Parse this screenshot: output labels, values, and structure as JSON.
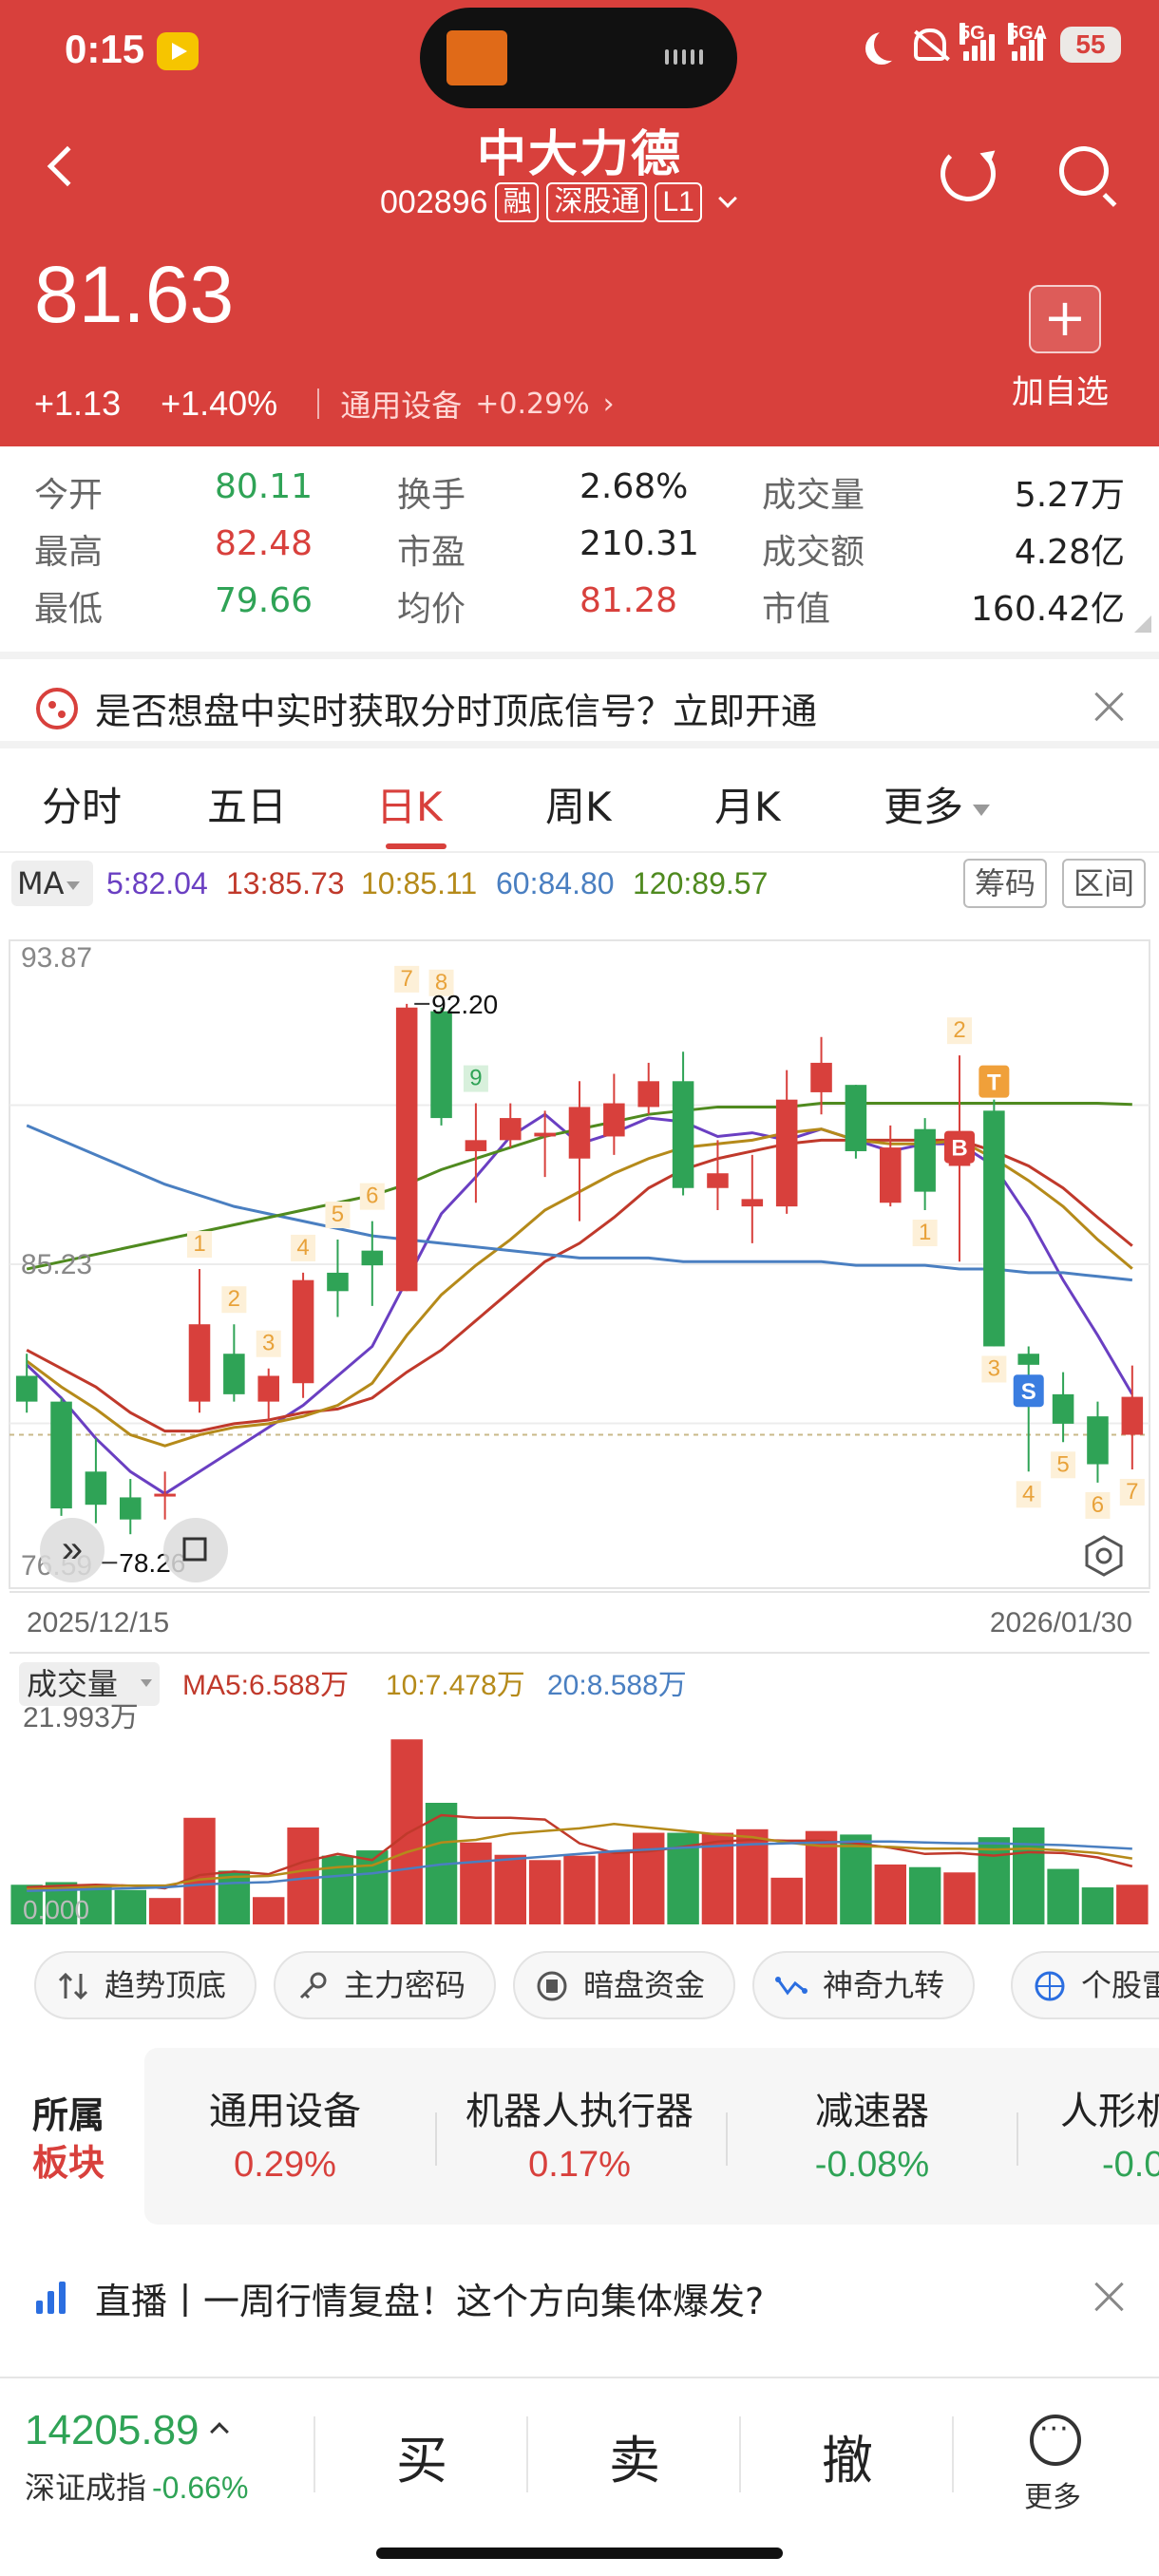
{
  "status_bar": {
    "time": "0:15",
    "battery": "55",
    "signal1": "5G",
    "signal2": "5GA"
  },
  "stock": {
    "name": "中大力德",
    "code": "002896",
    "tags": [
      "融",
      "深股通",
      "L1"
    ],
    "price": "81.63",
    "change": "+1.13",
    "change_pct": "+1.40%",
    "industry": "通用设备",
    "industry_pct": "+0.29%",
    "add_watch_label": "加自选",
    "colors": {
      "up": "#d8403c",
      "down": "#2fa356",
      "header_bg": "#d8403c"
    }
  },
  "stats": [
    {
      "label": "今开",
      "value": "80.11"
    },
    {
      "label": "换手",
      "value": "2.68%"
    },
    {
      "label": "成交量",
      "value": "5.27万"
    },
    {
      "label": "最高",
      "value": "82.48"
    },
    {
      "label": "市盈",
      "value": "210.31"
    },
    {
      "label": "成交额",
      "value": "4.28亿"
    },
    {
      "label": "最低",
      "value": "79.66"
    },
    {
      "label": "均价",
      "value": "81.28"
    },
    {
      "label": "市值",
      "value": "160.42亿"
    }
  ],
  "signal_banner": {
    "text": "是否想盘中实时获取分时顶底信号？立即开通"
  },
  "chart_tabs": {
    "items": [
      "分时",
      "五日",
      "日K",
      "周K",
      "月K",
      "更多"
    ],
    "active": "日K"
  },
  "ma": {
    "selector": "MA",
    "items": [
      {
        "label": "5:82.04",
        "color": "#6a3fc2"
      },
      {
        "label": "13:85.73",
        "color": "#c0392b"
      },
      {
        "label": "10:85.11",
        "color": "#b58a1a"
      },
      {
        "label": "60:84.80",
        "color": "#4a7fc1"
      },
      {
        "label": "120:89.57",
        "color": "#4f8a1f"
      }
    ],
    "buttons": [
      "筹码",
      "区间"
    ]
  },
  "chart_data": {
    "type": "candlestick",
    "y_axis_labels": [
      "93.87",
      "85.23",
      "76.59"
    ],
    "ylim": [
      76.59,
      93.87
    ],
    "date_start": "2025/12/15",
    "date_end": "2026/01/30",
    "high_annotation": "92.20",
    "low_annotation": "78.26",
    "candles": [
      {
        "o": 82.2,
        "c": 81.5,
        "h": 82.8,
        "l": 81.2
      },
      {
        "o": 81.5,
        "c": 78.6,
        "h": 81.6,
        "l": 78.4
      },
      {
        "o": 79.6,
        "c": 78.7,
        "h": 80.5,
        "l": 78.2
      },
      {
        "o": 78.9,
        "c": 78.3,
        "h": 79.4,
        "l": 77.9
      },
      {
        "o": 79.0,
        "c": 79.0,
        "h": 79.6,
        "l": 78.3
      },
      {
        "o": 81.5,
        "c": 83.6,
        "h": 85.1,
        "l": 81.2
      },
      {
        "o": 82.8,
        "c": 81.7,
        "h": 83.6,
        "l": 81.5
      },
      {
        "o": 81.5,
        "c": 82.2,
        "h": 82.4,
        "l": 81.0
      },
      {
        "o": 82.0,
        "c": 84.8,
        "h": 85.0,
        "l": 81.6
      },
      {
        "o": 85.0,
        "c": 84.5,
        "h": 85.9,
        "l": 83.8
      },
      {
        "o": 85.6,
        "c": 85.2,
        "h": 86.4,
        "l": 84.1
      },
      {
        "o": 84.5,
        "c": 92.2,
        "h": 92.3,
        "l": 84.5
      },
      {
        "o": 92.1,
        "c": 89.2,
        "h": 92.2,
        "l": 89.0
      },
      {
        "o": 88.3,
        "c": 88.6,
        "h": 89.6,
        "l": 86.9
      },
      {
        "o": 88.6,
        "c": 89.2,
        "h": 89.6,
        "l": 88.4
      },
      {
        "o": 88.7,
        "c": 88.8,
        "h": 89.4,
        "l": 87.6
      },
      {
        "o": 88.1,
        "c": 89.5,
        "h": 90.2,
        "l": 86.4
      },
      {
        "o": 88.7,
        "c": 89.6,
        "h": 90.4,
        "l": 88.2
      },
      {
        "o": 89.5,
        "c": 90.2,
        "h": 90.7,
        "l": 89.3
      },
      {
        "o": 90.2,
        "c": 87.3,
        "h": 91.0,
        "l": 87.1
      },
      {
        "o": 87.3,
        "c": 87.7,
        "h": 88.6,
        "l": 86.7
      },
      {
        "o": 86.8,
        "c": 87.0,
        "h": 88.2,
        "l": 85.8
      },
      {
        "o": 86.8,
        "c": 89.7,
        "h": 90.5,
        "l": 86.6
      },
      {
        "o": 89.9,
        "c": 90.7,
        "h": 91.4,
        "l": 89.3
      },
      {
        "o": 90.1,
        "c": 88.3,
        "h": 90.1,
        "l": 88.1
      },
      {
        "o": 86.9,
        "c": 88.4,
        "h": 89.0,
        "l": 86.8
      },
      {
        "o": 88.9,
        "c": 87.2,
        "h": 89.2,
        "l": 86.7
      },
      {
        "o": 87.9,
        "c": 88.8,
        "h": 90.9,
        "l": 85.3
      },
      {
        "o": 89.4,
        "c": 83.0,
        "h": 89.7,
        "l": 83.0
      },
      {
        "o": 82.8,
        "c": 82.5,
        "h": 83.0,
        "l": 79.6
      },
      {
        "o": 81.7,
        "c": 80.9,
        "h": 82.3,
        "l": 80.4
      },
      {
        "o": 81.1,
        "c": 79.8,
        "h": 81.5,
        "l": 79.3
      },
      {
        "o": 80.6,
        "c": 81.63,
        "h": 82.48,
        "l": 79.66
      }
    ],
    "ma_lines": [
      {
        "name": "MA5",
        "color": "#6a3fc2",
        "values": [
          82.5,
          81.6,
          80.5,
          79.6,
          79.0,
          79.6,
          80.2,
          80.8,
          81.4,
          82.2,
          83.0,
          84.8,
          86.6,
          87.6,
          88.7,
          89.3,
          88.5,
          88.8,
          89.2,
          89.1,
          88.7,
          88.8,
          88.6,
          88.9,
          88.6,
          88.3,
          88.5,
          88.5,
          87.9,
          86.5,
          84.8,
          83.3,
          81.7
        ]
      },
      {
        "name": "MA13",
        "color": "#c0392b",
        "values": [
          82.9,
          82.4,
          81.9,
          81.2,
          80.7,
          80.7,
          80.9,
          81.0,
          81.2,
          81.3,
          81.6,
          82.3,
          82.9,
          83.7,
          84.5,
          85.3,
          85.8,
          86.5,
          87.3,
          87.8,
          88.1,
          88.3,
          88.5,
          88.6,
          88.6,
          88.6,
          88.6,
          88.6,
          88.3,
          87.9,
          87.3,
          86.5,
          85.73
        ]
      },
      {
        "name": "MA10",
        "color": "#b58a1a",
        "values": [
          82.6,
          81.9,
          81.3,
          80.6,
          80.3,
          80.6,
          80.8,
          80.9,
          81.1,
          81.4,
          82.0,
          83.3,
          84.4,
          85.2,
          85.9,
          86.7,
          87.2,
          87.7,
          88.1,
          88.4,
          88.5,
          88.6,
          88.8,
          88.9,
          88.6,
          88.5,
          88.5,
          88.6,
          88.1,
          87.5,
          86.8,
          85.9,
          85.11
        ]
      },
      {
        "name": "MA60",
        "color": "#4a7fc1",
        "values": [
          89.0,
          88.6,
          88.2,
          87.8,
          87.4,
          87.1,
          86.8,
          86.6,
          86.4,
          86.2,
          86.0,
          85.9,
          85.8,
          85.7,
          85.6,
          85.5,
          85.4,
          85.4,
          85.4,
          85.3,
          85.3,
          85.3,
          85.3,
          85.3,
          85.2,
          85.2,
          85.2,
          85.1,
          85.1,
          85.0,
          85.0,
          84.9,
          84.8
        ]
      },
      {
        "name": "MA120",
        "color": "#4f8a1f",
        "values": [
          85.1,
          85.3,
          85.5,
          85.7,
          85.9,
          86.1,
          86.3,
          86.5,
          86.7,
          86.9,
          87.1,
          87.4,
          87.8,
          88.1,
          88.4,
          88.7,
          88.9,
          89.1,
          89.3,
          89.4,
          89.5,
          89.5,
          89.5,
          89.6,
          89.6,
          89.6,
          89.6,
          89.6,
          89.6,
          89.6,
          89.6,
          89.6,
          89.57
        ]
      }
    ],
    "markers": [
      {
        "i": 5,
        "text": "1",
        "pos": "above"
      },
      {
        "i": 6,
        "text": "2",
        "pos": "above"
      },
      {
        "i": 7,
        "text": "3",
        "pos": "above"
      },
      {
        "i": 8,
        "text": "4",
        "pos": "above"
      },
      {
        "i": 9,
        "text": "5",
        "pos": "above"
      },
      {
        "i": 10,
        "text": "6",
        "pos": "above"
      },
      {
        "i": 11,
        "text": "7",
        "pos": "above"
      },
      {
        "i": 12,
        "text": "8",
        "pos": "above"
      },
      {
        "i": 13,
        "text": "9",
        "pos": "above",
        "style": "green"
      },
      {
        "i": 26,
        "text": "1",
        "pos": "below"
      },
      {
        "i": 27,
        "text": "2",
        "pos": "above"
      },
      {
        "i": 28,
        "text": "3",
        "pos": "below"
      },
      {
        "i": 29,
        "text": "4",
        "pos": "below"
      },
      {
        "i": 30,
        "text": "5",
        "pos": "below"
      },
      {
        "i": 31,
        "text": "6",
        "pos": "below"
      },
      {
        "i": 32,
        "text": "7",
        "pos": "below"
      },
      {
        "i": 27,
        "text": "B",
        "pos": "mid-low",
        "style": "badge-red"
      },
      {
        "i": 29,
        "text": "S",
        "pos": "mid-high",
        "style": "badge-blue"
      },
      {
        "i": 28,
        "text": "T",
        "pos": "top",
        "style": "badge-orange"
      }
    ],
    "volume": {
      "selector": "成交量",
      "ma_labels": [
        {
          "label": "MA5:6.588万",
          "color": "#c0392b"
        },
        {
          "label": "10:7.478万",
          "color": "#b58a1a"
        },
        {
          "label": "20:8.588万",
          "color": "#4a7fc1"
        }
      ],
      "max_label": "21.993万",
      "min_label": "0.000",
      "ylim": [
        0,
        21.993
      ],
      "values": [
        4.5,
        4.8,
        4.3,
        3.9,
        3.0,
        12.1,
        6.1,
        3.1,
        11.0,
        7.8,
        8.4,
        21.0,
        13.8,
        9.3,
        7.9,
        7.3,
        7.8,
        8.2,
        10.4,
        10.4,
        10.4,
        10.8,
        5.3,
        10.6,
        10.2,
        6.8,
        6.5,
        5.9,
        9.9,
        11.0,
        6.3,
        4.2,
        4.5
      ],
      "ma5": [
        4.2,
        4.4,
        4.5,
        4.4,
        4.1,
        5.6,
        6.0,
        5.7,
        7.1,
        8.0,
        7.3,
        10.3,
        12.4,
        12.1,
        12.1,
        11.9,
        9.2,
        8.1,
        8.3,
        8.8,
        9.4,
        9.6,
        9.5,
        9.5,
        9.2,
        8.7,
        8.0,
        8.1,
        7.8,
        8.2,
        8.1,
        7.6,
        6.588
      ],
      "ma10": [
        4.0,
        4.1,
        4.3,
        4.4,
        4.4,
        5.1,
        5.4,
        5.5,
        6.1,
        6.5,
        6.7,
        8.2,
        9.3,
        9.6,
        10.3,
        10.6,
        10.9,
        11.4,
        11.0,
        10.6,
        10.2,
        9.9,
        9.3,
        8.9,
        8.9,
        8.8,
        8.6,
        8.6,
        8.5,
        8.6,
        8.4,
        8.1,
        7.478
      ],
      "ma20": [
        3.8,
        3.9,
        4.0,
        4.1,
        4.2,
        4.5,
        4.7,
        4.8,
        5.2,
        5.5,
        5.8,
        6.3,
        6.8,
        7.1,
        7.4,
        7.7,
        8.0,
        8.3,
        8.5,
        8.7,
        8.9,
        9.1,
        9.2,
        9.3,
        9.4,
        9.4,
        9.3,
        9.2,
        9.2,
        9.1,
        9.0,
        8.8,
        8.588
      ]
    }
  },
  "tools": [
    "趋势顶底",
    "主力密码",
    "暗盘资金",
    "神奇九转",
    "个股雷"
  ],
  "sectors": {
    "title_line1": "所属",
    "title_line2": "板块",
    "items": [
      {
        "name": "通用设备",
        "pct": "0.29%",
        "dir": "up"
      },
      {
        "name": "机器人执行器",
        "pct": "0.17%",
        "dir": "up"
      },
      {
        "name": "减速器",
        "pct": "-0.08%",
        "dir": "down"
      },
      {
        "name": "人形机",
        "pct": "-0.0",
        "dir": "down"
      }
    ]
  },
  "live": {
    "text": "直播丨一周行情复盘！这个方向集体爆发?"
  },
  "bottom": {
    "index_value": "14205.89",
    "index_name": "深证成指",
    "index_pct": "-0.66%",
    "buy": "买",
    "sell": "卖",
    "cancel": "撤",
    "more": "更多"
  }
}
